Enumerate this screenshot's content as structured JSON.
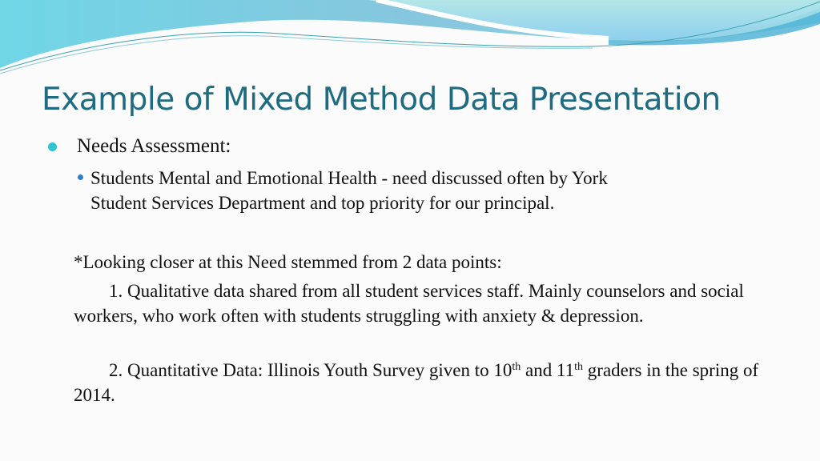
{
  "slide": {
    "title": "Example of Mixed Method Data Presentation",
    "bullet_level1": "Needs Assessment:",
    "bullet_level2_line1": "Students Mental and Emotional Health  - need discussed often by York",
    "bullet_level2_line2": "Student Services Department  and top priority for our principal.",
    "note_intro": "*Looking closer at this Need stemmed from 2 data points:",
    "point1": "1. Qualitative data shared from all student services staff. Mainly counselors and social workers, who work often with students struggling with anxiety & depression.",
    "point2_part1": "2. Quantitative Data: Illinois Youth Survey given to 10",
    "point2_sup1": "th",
    "point2_part2": " and 11",
    "point2_sup2": "th",
    "point2_part3": " graders in the spring of 2014."
  },
  "colors": {
    "title": "#1f6b82",
    "bullet1": "#2ec4d4",
    "bullet2": "#2a7fd0",
    "banner_light": "#a8e2ea",
    "banner_mid": "#7cc8dc",
    "banner_dark": "#4bb0d6"
  }
}
